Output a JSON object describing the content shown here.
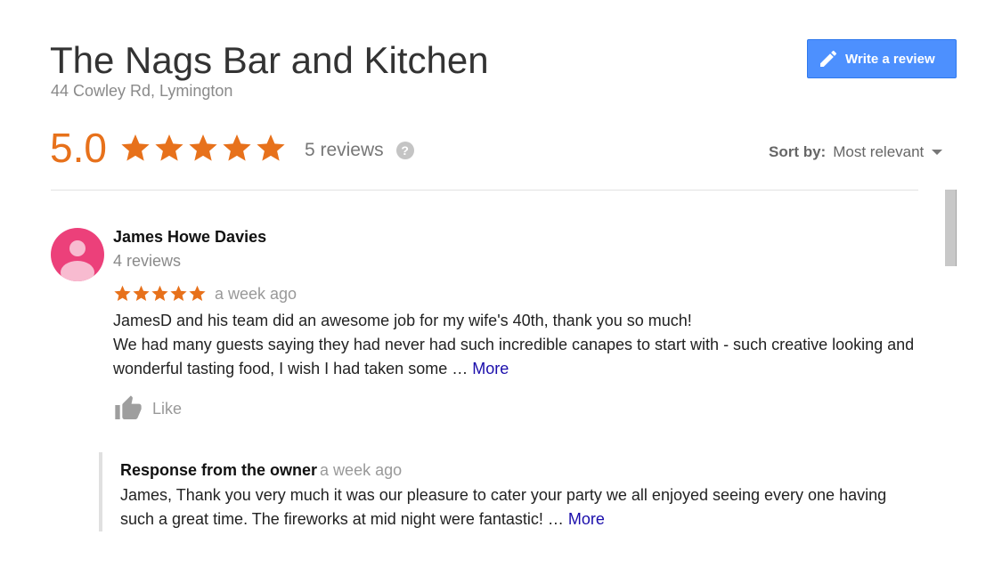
{
  "place": {
    "name": "The Nags Bar and Kitchen",
    "address": "44 Cowley Rd, Lymington"
  },
  "write_review": {
    "label": "Write a review",
    "icon": "pencil-icon"
  },
  "summary": {
    "rating_text": "5.0",
    "rating": 5,
    "review_count_label": "5 reviews",
    "star_color": "#e7711b"
  },
  "sort": {
    "label": "Sort by:",
    "value": "Most relevant"
  },
  "review": {
    "author": "James Howe Davies",
    "author_reviews": "4 reviews",
    "stars": 5,
    "date": "a week ago",
    "text_line1": "JamesD and his team did an awesome job for my wife's 40th, thank you so much!",
    "text_line2": "We had many guests saying they had never had such incredible canapes to start with - such creative looking and wonderful tasting food, I wish I had taken some … ",
    "more_label": "More",
    "like_label": "Like",
    "avatar_color": "#ec407a"
  },
  "owner_response": {
    "heading": "Response from the owner",
    "date": "a week ago",
    "text": "James, Thank you very much it was our pleasure to cater your party we all enjoyed seeing every one having such a great time. The fireworks at mid night were fantastic! … ",
    "more_label": "More"
  }
}
